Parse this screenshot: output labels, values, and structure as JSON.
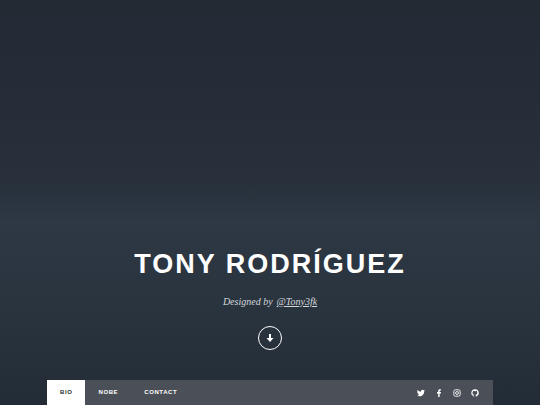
{
  "hero": {
    "title": "TONY RODRÍGUEZ",
    "credit_prefix": "Designed by",
    "credit_link": "@Tony3fk"
  },
  "nav": {
    "items": [
      {
        "label": "BIO",
        "selected": true
      },
      {
        "label": "NOBE",
        "selected": false
      },
      {
        "label": "CONTACT",
        "selected": false
      }
    ]
  }
}
